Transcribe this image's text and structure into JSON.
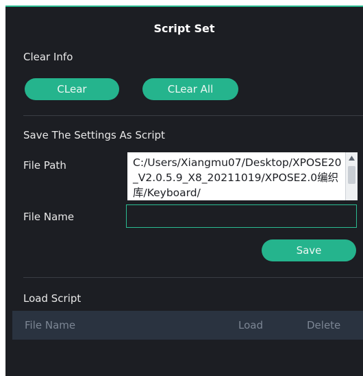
{
  "window": {
    "title": "Script Set"
  },
  "clear_section": {
    "label": "Clear Info",
    "clear_button": "CLear",
    "clear_all_button": "CLear All"
  },
  "save_section": {
    "label": "Save The Settings As Script",
    "file_path_label": "File Path",
    "file_path_value": "C:/Users/Xiangmu07/Desktop/XPOSE20_V2.0.5.9_X8_20211019/XPOSE2.0编织库/Keyboard/",
    "file_name_label": "File Name",
    "file_name_value": "",
    "save_button": "Save"
  },
  "load_section": {
    "label": "Load Script",
    "columns": [
      "File Name",
      "Load",
      "Delete"
    ],
    "rows": []
  },
  "colors": {
    "accent": "#2bbd93",
    "panel_bg": "#1c1e23",
    "table_header_bg": "#2a3340"
  },
  "icons": {
    "scroll_up": "triangle-up-icon"
  }
}
